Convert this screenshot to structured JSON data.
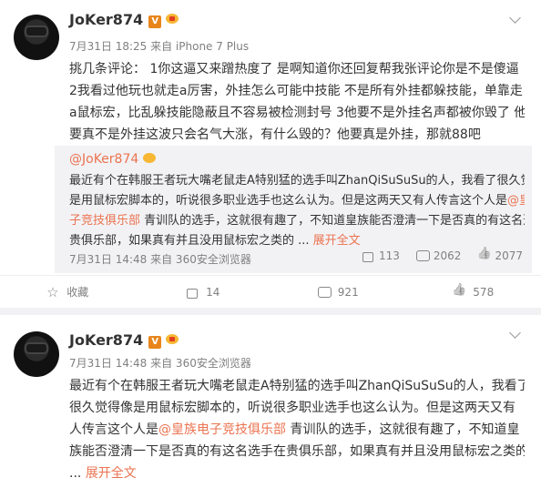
{
  "post1": {
    "author": "JoKer874",
    "vip_badge": "V",
    "meta": "7月31日 18:25 来自 iPhone 7 Plus",
    "lines": [
      "挑几条评论： 1你这逼又来蹭热度了 是啊知道你还回复帮我张评论你是不是傻逼",
      "2我看过他玩也就走a厉害，外挂怎么可能中技能 不是所有外挂都躲技能，单靠走",
      "a鼠标宏，比乱躲技能隐蔽且不容易被检测封号 3他要不是外挂名声都被你毁了 他",
      "要真不是外挂这波只会名气大涨，有什么毁的？他要真是外挂，那就88吧"
    ],
    "quote": {
      "author": "@JoKer874",
      "lines": [
        "最近有个在韩服王者玩大嘴老鼠走A特别猛的选手叫ZhanQiSuSuSu的人，我看了很久觉得像",
        "是用鼠标宏脚本的，听说很多职业选手也这么认为。但是这两天又有人传言这个人是",
        "子竞技俱乐部",
        " 青训队的选手，这就很有趣了，不知道皇族能否澄清一下是否真的有这名选手在",
        "贵俱乐部，如果真有并且没用鼠标宏之类的 ...",
        "展开全文"
      ],
      "link_part1": "@皇族电",
      "meta": "7月31日 14:48 来自 360安全浏览器",
      "shares": "113",
      "comments": "2062",
      "likes": "2077"
    },
    "actions": {
      "collect": "收藏",
      "share": "14",
      "comment": "921",
      "like": "578"
    }
  },
  "post2": {
    "author": "JoKer874",
    "vip_badge": "V",
    "meta": "7月31日 14:48 来自 360安全浏览器",
    "line1": "最近有个在韩服王者玩大嘴老鼠走A特别猛的选手叫ZhanQiSuSuSu的人，我看了",
    "line2": "很久觉得像是用鼠标宏脚本的，听说很多职业选手也这么认为。但是这两天又有",
    "line3_pre": "人传言这个人是",
    "line3_link": "@皇族电子竞技俱乐部",
    "line3_post": " 青训队的选手，这就很有趣了，不知道皇",
    "line4": "族能否澄清一下是否真的有这名选手在贵俱乐部，如果真有并且没用鼠标宏之类的",
    "line5_pre": "...",
    "line5_more": "展开全文"
  }
}
